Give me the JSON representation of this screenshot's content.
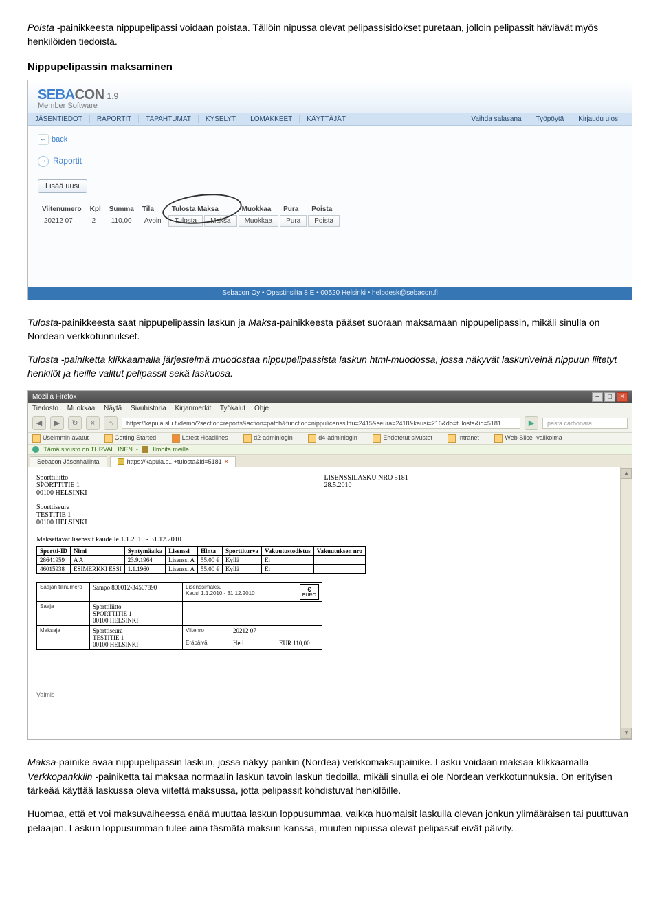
{
  "intro1_italic": "Poista ",
  "intro1_rest": "-painikkeesta nippupelipassi voidaan poistaa. Tällöin nipussa olevat pelipassisidokset puretaan, jolloin pelipassit häviävät myös henkilöiden tiedoista.",
  "h1": "Nippupelipassin maksaminen",
  "sc1": {
    "brand_s": "SEBA",
    "brand_b": "CON",
    "ver": "1.9",
    "sub": "Member Software",
    "menu_left": [
      "JÄSENTIEDOT",
      "RAPORTIT",
      "TAPAHTUMAT",
      "KYSELYT",
      "LOMAKKEET",
      "KÄYTTÄJÄT"
    ],
    "menu_right": [
      "Vaihda salasana",
      "Työpöytä",
      "Kirjaudu ulos"
    ],
    "back": "back",
    "panel": "Raportit",
    "lisaa": "Lisää uusi",
    "headers": [
      "Viitenumero",
      "Kpl",
      "Summa",
      "Tila",
      "Tulosta",
      "Maksa",
      "Muokkaa",
      "Pura",
      "Poista"
    ],
    "row": {
      "viite": "20212 07",
      "kpl": "2",
      "summa": "110,00",
      "tila": "Avoin",
      "tulosta": "Tulosta",
      "maksa": "Maksa",
      "muokkaa": "Muokkaa",
      "pura": "Pura",
      "poista": "Poista"
    },
    "foot": "Sebacon Oy • Opastinsilta 8 E • 00520 Helsinki • helpdesk@sebacon.fi"
  },
  "para2_italic1": "Tulosta",
  "para2_mid1": "-painikkeesta saat nippupelipassin laskun ja ",
  "para2_italic2": "Maksa",
  "para2_mid2": "-painikkeesta pääset suoraan maksamaan nippupelipassin, mikäli sinulla on Nordean verkkotunnukset.",
  "para3_italic": "Tulosta ",
  "para3_rest": "-painiketta klikkaamalla järjestelmä muodostaa nippupelipassista laskun html-muodossa, jossa näkyvät laskuriveinä nippuun liitetyt henkilöt ja heille valitut pelipassit sekä laskuosa.",
  "sc2": {
    "title": "Mozilla Firefox",
    "fmenu": [
      "Tiedosto",
      "Muokkaa",
      "Näytä",
      "Sivuhistoria",
      "Kirjanmerkit",
      "Työkalut",
      "Ohje"
    ],
    "url": "https://kapula.slu.fi/demo/?section=reports&action=patch&function=nippulicenssilttu=2415&seura=2418&kausi=216&do=tulosta&id=5181",
    "search_ph": "pasta carbonara",
    "bookmarks": [
      "Useimmin avatut",
      "Getting Started",
      "Latest Headlines",
      "d2-adminlogin",
      "d4-adminlogin",
      "Ehdotetut sivustot",
      "Intranet",
      "Web Slice -valikoima"
    ],
    "status_left": "Tämä sivusto on TURVALLINEN",
    "status_right": "Ilmoita meille",
    "tab1": "Sebacon Jäsenhallinta",
    "tab2": "https://kapula.s...+tulosta&id=5181",
    "inv": {
      "sender": [
        "Sporttiliitto",
        "SPORTTITIE 1",
        "00100 HELSINKI"
      ],
      "title": "LISENSSILASKU NRO 5181",
      "date": "28.5.2010",
      "recipient": [
        "Sporttiseura",
        "TESTITIE 1",
        "00100 HELSINKI"
      ],
      "periodLbl": "Maksettavat lisenssit kaudelle 1.1.2010 - 31.12.2010",
      "cols": [
        "Sportti-ID",
        "Nimi",
        "Syntymäaika",
        "Lisenssi",
        "Hinta",
        "Sporttiturva",
        "Vakuutustodistus",
        "Vakuutuksen nro"
      ],
      "rows": [
        {
          "id": "28641959",
          "nimi": "A A",
          "synt": "23.9.1964",
          "lis": "Lisenssi A",
          "hinta": "55,00 €",
          "turva": "Kyllä",
          "todistus": "Ei",
          "nro": ""
        },
        {
          "id": "46015938",
          "nimi": "ESIMERKKI ESSI",
          "synt": "1.1.1960",
          "lis": "Lisenssi A",
          "hinta": "55,00 €",
          "turva": "Kyllä",
          "todistus": "Ei",
          "nro": ""
        }
      ],
      "pay": {
        "saajan_tili_lbl": "Saajan tilinumero",
        "saajan_tili": "Sampo 800012-34567890",
        "lisnimike_lbl": "Lisenssimaksu",
        "kausi": "Kausi 1.1.2010 - 31.12.2010",
        "saaja_lbl": "Saaja",
        "saaja": "Sporttiliitto\nSPORTTITIE 1\n00100 HELSINKI",
        "maksaja_lbl": "Maksaja",
        "maksaja": "Sporttiseura\nTESTITIE 1\n00100 HELSINKI",
        "viite_lbl": "Viitenro",
        "viite": "20212 07",
        "era_lbl": "Eräpäivä",
        "era": "Heti",
        "sum_lbl": "EUR",
        "sum": "110,00",
        "euro": "EURO"
      }
    },
    "valmis": "Valmis"
  },
  "para4a_ital": "Maksa",
  "para4a_rest": "-painike avaa nippupelipassin laskun, jossa näkyy pankin (Nordea) verkkomaksupainike. Lasku voidaan maksaa klikkaamalla ",
  "para4b_ital": "Verkkopankkiin ",
  "para4b_rest": "-painiketta tai maksaa normaalin laskun tavoin laskun tiedoilla, mikäli sinulla ei ole Nordean verkkotunnuksia. On erityisen tärkeää käyttää laskussa oleva viitettä maksussa, jotta pelipassit kohdistuvat henkilöille.",
  "para5": "Huomaa, että et voi maksuvaiheessa enää muuttaa laskun loppusummaa, vaikka huomaisit laskulla olevan jonkun ylimääräisen tai puuttuvan pelaajan.  Laskun loppusumman tulee aina täsmätä maksun kanssa, muuten nipussa olevat pelipassit eivät päivity."
}
